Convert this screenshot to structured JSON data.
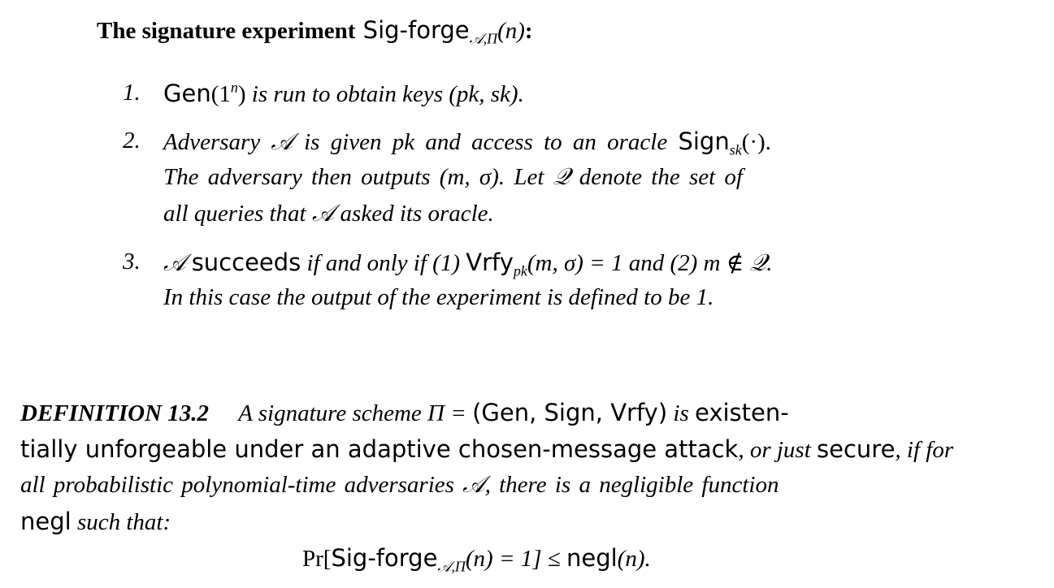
{
  "experiment": {
    "title_bold": "The signature experiment",
    "title_func": "Sig-forge",
    "title_sub": "𝒜,Π",
    "title_arg": "(n)",
    "title_colon": ":",
    "steps": [
      {
        "number": "1.",
        "line1_gen": "Gen",
        "line1_gen_arg": "(1",
        "line1_gen_sup": "n",
        "line1_gen_close": ")",
        "line1_rest": "is run to obtain keys (pk, sk)."
      },
      {
        "number": "2.",
        "line1_text": "Adversary 𝒜 is given pk and access to an oracle",
        "line1_sign": "Sign",
        "line1_sign_sub": "sk",
        "line1_sign_arg": "(·).",
        "line2": "The adversary then outputs (m, σ). Let 𝒬 denote the set of",
        "line3": "all queries that 𝒜 asked its oracle."
      },
      {
        "number": "3.",
        "line1_a": "𝒜",
        "line1_succeeds": "succeeds",
        "line1_mid": "if and only if (1)",
        "line1_vrfy": "Vrfy",
        "line1_vrfy_sub": "pk",
        "line1_end": "(m, σ) = 1 and (2) m ∉ 𝒬.",
        "line2": "In this case the output of the experiment is defined to be 1."
      }
    ]
  },
  "definition": {
    "label": "DEFINITION 13.2",
    "line1_intro": "A signature scheme Π =",
    "line1_tuple": "(Gen, Sign, Vrfy)",
    "line1_is": "is",
    "line1_end": "existen-",
    "line2_a": "tially unforgeable under an adaptive chosen-message attack",
    "line2_b": ", or just",
    "line2_c": "secure",
    "line2_d": ", if for",
    "line3": "all probabilistic polynomial-time adversaries 𝒜, there is a negligible function",
    "line4_negl": "negl",
    "line4_rest": "such that:",
    "formula_pr": "Pr[",
    "formula_func": "Sig-forge",
    "formula_sub": "𝒜,Π",
    "formula_mid": "(n) = 1] ≤",
    "formula_negl": "negl",
    "formula_end": "(n)."
  }
}
